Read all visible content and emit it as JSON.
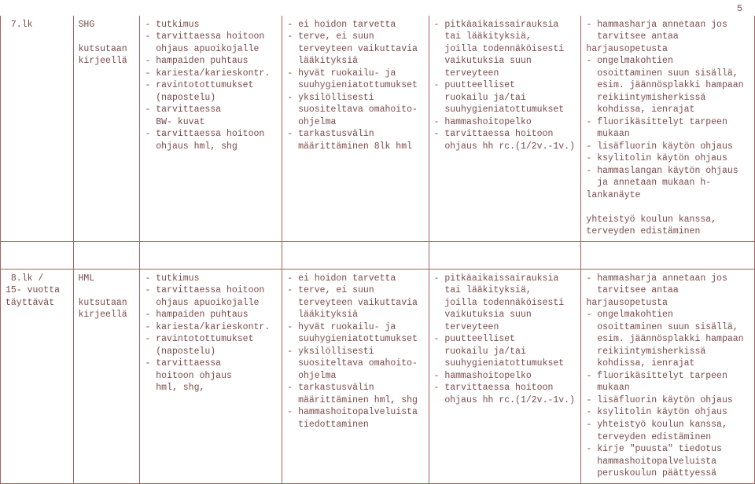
{
  "pageNumber": "5",
  "rows": [
    {
      "c1": " 7.lk",
      "c2": "SHG\n\nkutsutaan\nkirjeellä",
      "c3": "- tutkimus\n- tarvittaessa hoitoon\n  ohjaus apuoikojalle\n- hampaiden puhtaus\n- kariesta/karieskontr.\n- ravintotottumukset\n  (napostelu)\n- tarvittaessa\n  BW- kuvat\n- tarvittaessa hoitoon\n  ohjaus hml, shg",
      "c4": "- ei hoidon tarvetta\n- terve, ei suun\n  terveyteen vaikuttavia\n  lääkityksiä\n- hyvät ruokailu- ja\n  suuhygieniatottumukset\n- yksilöllisesti\n  suositeltava omahoito-\n  ohjelma\n- tarkastusvälin\n  määrittäminen 8lk hml",
      "c5": "- pitkäaikaissairauksia\n  tai lääkityksiä,\n  joilla todennäköisesti\n  vaikutuksia suun\n  terveyteen\n- puutteelliset\n  ruokailu ja/tai\n  suuhygieniatottumukset\n- hammashoitopelko\n- tarvittaessa hoitoon\n  ohjaus hh rc.(1/2v.-1v.)",
      "c6": "- hammasharja annetaan jos\n  tarvitsee antaa harjausopetusta\n- ongelmakohtien\n  osoittaminen suun sisällä,\n  esim. jäännösplakki hampaan\n  reikiintymisherkissä\n  kohdissa, ienrajat\n- fluorikäsittelyt tarpeen\n  mukaan\n- lisäfluorin käytön ohjaus\n- ksylitolin käytön ohjaus\n- hammaslangan käytön ohjaus\n  ja annetaan mukaan h-lankanäyte\n\nyhteistyö koulun kanssa,\nterveyden edistäminen"
    },
    {
      "c1": " 8.lk /\n15- vuotta\ntäyttävät",
      "c2": "HML\n\nkutsutaan\nkirjeellä",
      "c3": "- tutkimus\n- tarvittaessa hoitoon\n  ohjaus apuoikojalle\n- hampaiden puhtaus\n- kariesta/karieskontr.\n- ravintotottumukset\n  (napostelu)\n- tarvittaessa\n  hoitoon ohjaus\n  hml, shg,",
      "c4": "- ei hoidon tarvetta\n- terve, ei suun\n  terveyteen vaikuttavia\n  lääkityksiä\n- hyvät ruokailu- ja\n  suuhygieniatottumukset\n- yksilöllisesti\n  suositeltava omahoito-\n  ohjelma\n- tarkastusvälin\n  määrittäminen hml, shg\n- hammashoitopalveluista\n  tiedottaminen",
      "c5": "- pitkäaikaissairauksia\n  tai lääkityksiä,\n  joilla todennäköisesti\n  vaikutuksia suun\n  terveyteen\n- puutteelliset\n  ruokailu ja/tai\n  suuhygieniatottumukset\n- hammashoitopelko\n- tarvittaessa hoitoon\n  ohjaus hh rc.(1/2v.-1v.)",
      "c6": "- hammasharja annetaan jos\n  tarvitsee antaa harjausopetusta\n- ongelmakohtien\n  osoittaminen suun sisällä,\n  esim. jäännösplakki hampaan\n  reikiintymisherkissä\n  kohdissa, ienrajat\n- fluorikäsittelyt tarpeen\n  mukaan\n- lisäfluorin käytön ohjaus\n- ksylitolin käytön ohjaus\n- yhteistyö koulun kanssa,\n  terveyden edistäminen\n- kirje \"puusta\" tiedotus\n  hammashoitopalveluista\n  peruskoulun päättyessä"
    }
  ]
}
